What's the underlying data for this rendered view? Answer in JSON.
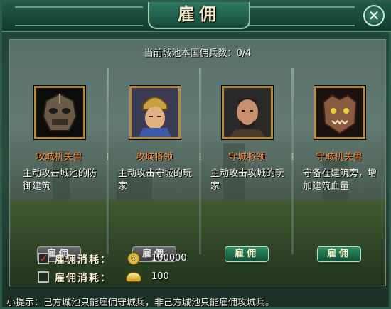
{
  "window": {
    "title": "雇佣",
    "close_glyph": "✕"
  },
  "info": {
    "mercenary_count_text": "当前城池本国佣兵数：0/4"
  },
  "units": [
    {
      "name": "攻城机关兽",
      "desc": "主动攻击城池的防御建筑",
      "button_label": "雇佣",
      "button_enabled": false,
      "portrait_icon": "beast-mask-icon"
    },
    {
      "name": "攻城将领",
      "desc": "主动攻击守城的玩家",
      "button_label": "雇佣",
      "button_enabled": false,
      "portrait_icon": "helmeted-general-icon"
    },
    {
      "name": "守城将领",
      "desc": "主动攻击攻城的玩家",
      "button_label": "雇佣",
      "button_enabled": true,
      "portrait_icon": "bearded-warrior-icon"
    },
    {
      "name": "守城机关兽",
      "desc": "守备在建筑旁，增加建筑血量",
      "button_label": "雇佣",
      "button_enabled": true,
      "portrait_icon": "armored-beast-icon"
    }
  ],
  "costs": [
    {
      "label": "雇佣消耗：",
      "checked": true,
      "currency_icon": "gold-coin-icon",
      "amount": "100000"
    },
    {
      "label": "雇佣消耗：",
      "checked": false,
      "currency_icon": "gold-ingot-icon",
      "amount": "100"
    }
  ],
  "tip": "小提示：己方城池只能雇佣守城兵，非己方城池只能雇佣攻城兵。",
  "colors": {
    "unit_name": "#ff8a3c",
    "button_active": "#2b8a64",
    "button_disabled": "#5a5a5a",
    "checkmark": "#ff2a2a"
  }
}
